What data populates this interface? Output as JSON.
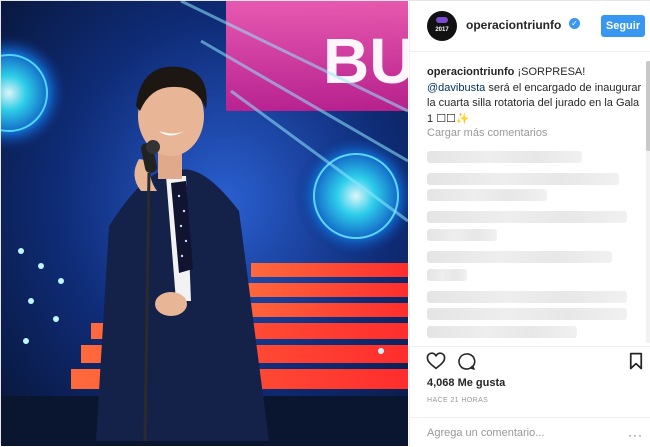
{
  "header": {
    "username": "operaciontriunfo",
    "follow_label": "Seguir",
    "avatar_text": "2017"
  },
  "caption": {
    "username": "operaciontriunfo",
    "text_1": " ¡SORPRESA! ",
    "mention": "@davibusta",
    "text_2": " será el encargado de inaugurar la cuarta silla rotatoria del jurado en la Gala 1 ",
    "emoji": "☐☐✨"
  },
  "load_more": "Cargar más comentarios",
  "likes": "4,068 Me gusta",
  "time": "HACE 21 HORAS",
  "add_comment": {
    "placeholder": "Agrega un comentario...",
    "more": "···"
  },
  "photo": {
    "sign_text": "BU"
  },
  "colors": {
    "accent": "#3897f0",
    "stage_blue": "#0b1a3d",
    "stage_red": "#ff4a3d"
  }
}
